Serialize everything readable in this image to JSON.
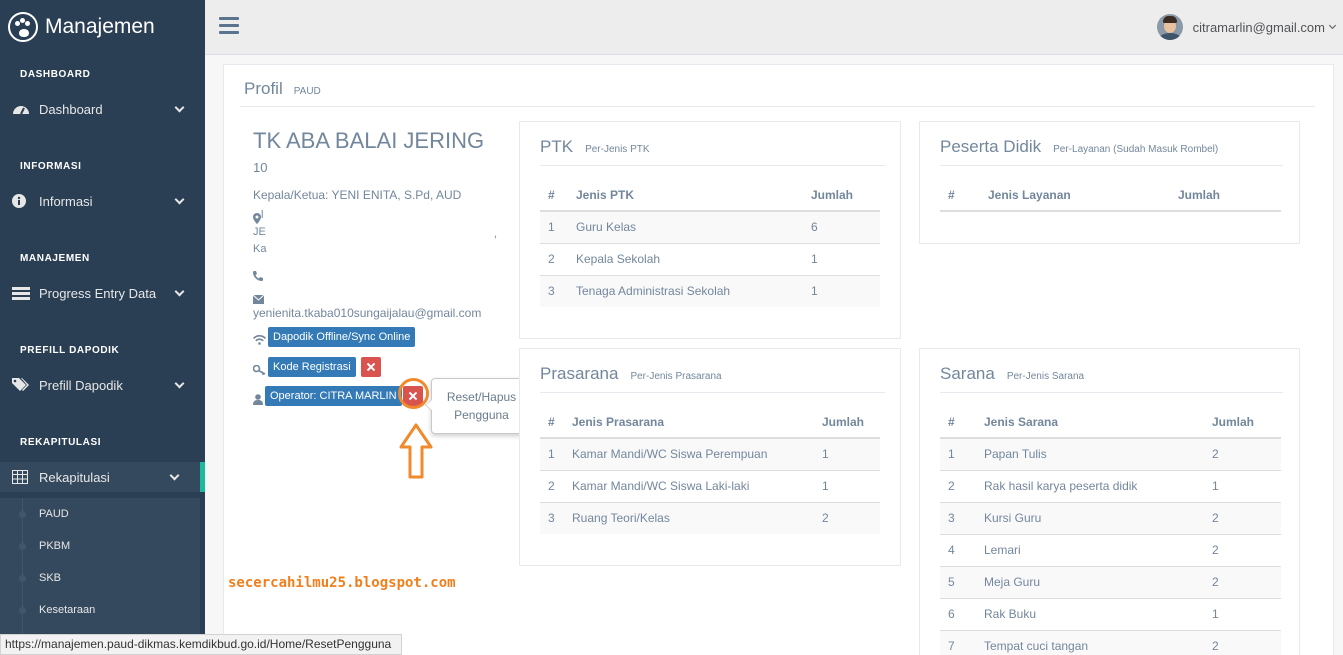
{
  "brand": {
    "title": "Manajemen"
  },
  "sidebar": {
    "sections": [
      {
        "title": "DASHBOARD",
        "item": "Dashboard"
      },
      {
        "title": "INFORMASI",
        "item": "Informasi"
      },
      {
        "title": "MANAJEMEN",
        "item": "Progress Entry Data"
      },
      {
        "title": "PREFILL DAPODIK",
        "item": "Prefill Dapodik"
      },
      {
        "title": "REKAPITULASI",
        "item": "Rekapitulasi"
      }
    ],
    "sub_items": [
      "PAUD",
      "PKBM",
      "SKB",
      "Kesetaraan"
    ]
  },
  "topnav": {
    "user_email": "citramarlin@gmail.com"
  },
  "profile": {
    "title": "Profil",
    "subtitle": "PAUD",
    "school_name": "TK ABA BALAI JERING",
    "npsn": "10",
    "kepala": "Kepala/Ketua: YENI ENITA, S.Pd, AUD",
    "address_line1": "l",
    "address_line2": "JE",
    "address_line3": "Ka",
    "address_comma": ",",
    "email": "yenienita.tkaba010sungaijalau@gmail.com",
    "btn_dapodik": "Dapodik Offline/Sync Online",
    "btn_kode": "Kode Registrasi",
    "btn_operator": "Operator: CITRA MARLIN",
    "tooltip": "Reset/Hapus Pengguna"
  },
  "ptk": {
    "title": "PTK",
    "subtitle": "Per-Jenis PTK",
    "headers": [
      "#",
      "Jenis PTK",
      "Jumlah"
    ],
    "rows": [
      [
        "1",
        "Guru Kelas",
        "6"
      ],
      [
        "2",
        "Kepala Sekolah",
        "1"
      ],
      [
        "3",
        "Tenaga Administrasi Sekolah",
        "1"
      ]
    ]
  },
  "peserta": {
    "title": "Peserta Didik",
    "subtitle": "Per-Layanan (Sudah Masuk Rombel)",
    "headers": [
      "#",
      "Jenis Layanan",
      "Jumlah"
    ]
  },
  "prasarana": {
    "title": "Prasarana",
    "subtitle": "Per-Jenis Prasarana",
    "headers": [
      "#",
      "Jenis Prasarana",
      "Jumlah"
    ],
    "rows": [
      [
        "1",
        "Kamar Mandi/WC Siswa Perempuan",
        "1"
      ],
      [
        "2",
        "Kamar Mandi/WC Siswa Laki-laki",
        "1"
      ],
      [
        "3",
        "Ruang Teori/Kelas",
        "2"
      ]
    ]
  },
  "sarana": {
    "title": "Sarana",
    "subtitle": "Per-Jenis Sarana",
    "headers": [
      "#",
      "Jenis Sarana",
      "Jumlah"
    ],
    "rows": [
      [
        "1",
        "Papan Tulis",
        "2"
      ],
      [
        "2",
        "Rak hasil karya peserta didik",
        "1"
      ],
      [
        "3",
        "Kursi Guru",
        "2"
      ],
      [
        "4",
        "Lemari",
        "2"
      ],
      [
        "5",
        "Meja Guru",
        "2"
      ],
      [
        "6",
        "Rak Buku",
        "1"
      ],
      [
        "7",
        "Tempat cuci tangan",
        "2"
      ]
    ]
  },
  "watermark": "secercahilmu25.blogspot.com",
  "status_url": "https://manajemen.paud-dikmas.kemdikbud.go.id/Home/ResetPengguna",
  "colors": {
    "sidebar": "#2a3f54",
    "accent": "#1abb9c",
    "primary": "#337ab7",
    "danger": "#d9534f",
    "highlight": "#f18a2c"
  }
}
